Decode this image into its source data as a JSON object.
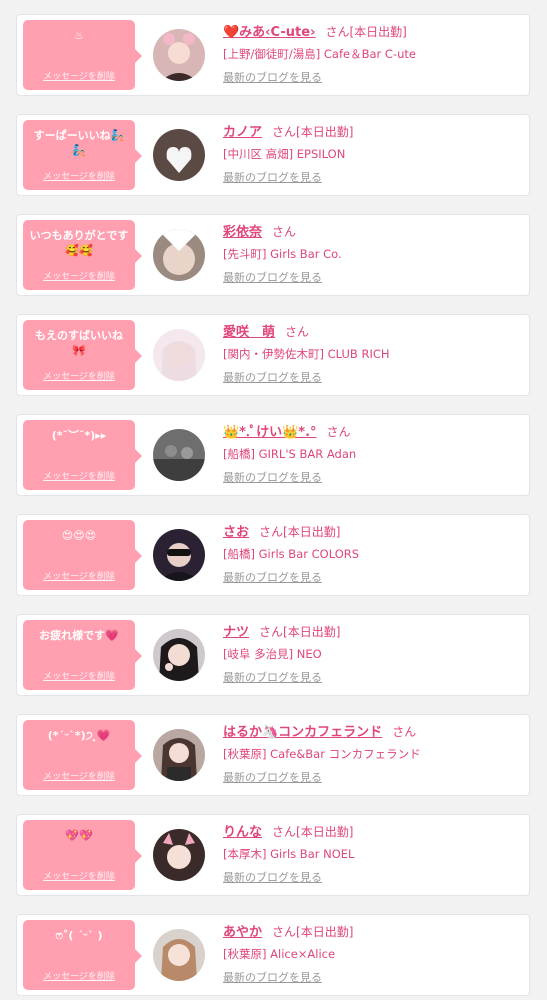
{
  "cards": [
    {
      "message": "♨",
      "delete_label": "メッセージを削除",
      "name": "❤️みあ‹C-ute›",
      "suffix": "さん[本日出勤]",
      "shop": "[上野/御徒町/湯島] Cafe＆Bar C-ute",
      "blog_link": "最新のブログを見る"
    },
    {
      "message": "すーぱーいいね🧞🧞",
      "delete_label": "メッセージを削除",
      "name": "カノア",
      "suffix": "さん[本日出勤]",
      "shop": "[中川区 高畑] EPSILON",
      "blog_link": "最新のブログを見る"
    },
    {
      "message": "いつもありがとです🥰🥰",
      "delete_label": "メッセージを削除",
      "name": "彩依奈",
      "suffix": "さん",
      "shop": "[先斗町] Girls Bar Co.",
      "blog_link": "最新のブログを見る"
    },
    {
      "message": "もえのすばいいね🎀",
      "delete_label": "メッセージを削除",
      "name": "愛咲　萌",
      "suffix": "さん",
      "shop": "[関内・伊勢佐木町] CLUB RICH",
      "blog_link": "最新のブログを見る"
    },
    {
      "message": "(*˘︶˘*)▸▸",
      "delete_label": "メッセージを削除",
      "name": "👑*.ﾟけい👑*.°",
      "suffix": "さん",
      "shop": "[船橋] GIRL'S BAR Adan",
      "blog_link": "最新のブログを見る"
    },
    {
      "message": "😍😍😍",
      "delete_label": "メッセージを削除",
      "name": "さお",
      "suffix": "さん[本日出勤]",
      "shop": "[船橋] Girls Bar COLORS",
      "blog_link": "最新のブログを見る"
    },
    {
      "message": "お疲れ様です💗",
      "delete_label": "メッセージを削除",
      "name": "ナツ",
      "suffix": "さん[本日出勤]",
      "shop": "[岐阜 多治見] NEO",
      "blog_link": "最新のブログを見る"
    },
    {
      "message": "(*ˊᵕˋ*)੭ ̥💗",
      "delete_label": "メッセージを削除",
      "name": "はるか🦄コンカフェランド",
      "suffix": "さん",
      "shop": "[秋葉原] Cafe&Bar コンカフェランド",
      "blog_link": "最新のブログを見る"
    },
    {
      "message": "💖💖",
      "delete_label": "メッセージを削除",
      "name": "りんな",
      "suffix": "さん[本日出勤]",
      "shop": "[本厚木] Girls Bar NOEL",
      "blog_link": "最新のブログを見る"
    },
    {
      "message": "ෆ˚( ˊᵕˋ )",
      "delete_label": "メッセージを削除",
      "name": "あやか",
      "suffix": "さん[本日出勤]",
      "shop": "[秋葉原] Alice×Alice",
      "blog_link": "最新のブログを見る"
    }
  ],
  "colors": {
    "accent": "#e0457b",
    "bubble": "#ff9fb0",
    "muted": "#999999"
  },
  "avatar_icons": [
    "avatar-photo",
    "avatar-photo",
    "avatar-photo",
    "avatar-photo",
    "avatar-photo",
    "avatar-photo",
    "avatar-photo",
    "avatar-photo",
    "avatar-photo",
    "avatar-photo"
  ]
}
